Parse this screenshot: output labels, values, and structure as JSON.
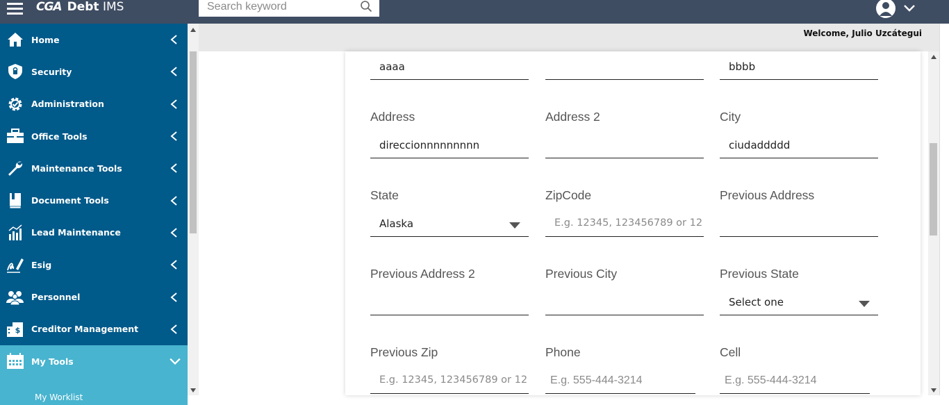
{
  "header": {
    "logo_mark": "CGA",
    "app_name_bold": "Debt",
    "app_name": "IMS",
    "search_placeholder": "Search keyword"
  },
  "welcome_text": "Welcome, Julio Uzcátegui",
  "sidebar": {
    "items": [
      {
        "label": "Home",
        "icon": "home-icon"
      },
      {
        "label": "Security",
        "icon": "shield-icon"
      },
      {
        "label": "Administration",
        "icon": "gear-icon"
      },
      {
        "label": "Office Tools",
        "icon": "toolbox-icon"
      },
      {
        "label": "Maintenance Tools",
        "icon": "wrench-icon"
      },
      {
        "label": "Document Tools",
        "icon": "book-icon"
      },
      {
        "label": "Lead Maintenance",
        "icon": "chart-icon"
      },
      {
        "label": "Esig",
        "icon": "signature-icon"
      },
      {
        "label": "Personnel",
        "icon": "people-icon"
      },
      {
        "label": "Creditor Management",
        "icon": "building-icon"
      },
      {
        "label": "My Tools",
        "icon": "calendar-icon"
      }
    ],
    "sub_items": [
      "My Worklist"
    ]
  },
  "form": {
    "row0": {
      "c1_value": "aaaa",
      "c2_value": "",
      "c3_value": "bbbb"
    },
    "address": {
      "label": "Address",
      "value": "direccionnnnnnnnn"
    },
    "address2": {
      "label": "Address 2",
      "value": ""
    },
    "city": {
      "label": "City",
      "value": "ciudaddddd"
    },
    "state": {
      "label": "State",
      "value": "Alaska"
    },
    "zipcode": {
      "label": "ZipCode",
      "placeholder": "E.g. 12345, 123456789 or 12"
    },
    "previous_address": {
      "label": "Previous Address",
      "value": ""
    },
    "previous_address2": {
      "label": "Previous Address 2",
      "value": ""
    },
    "previous_city": {
      "label": "Previous City",
      "value": ""
    },
    "previous_state": {
      "label": "Previous State",
      "value": "Select one"
    },
    "previous_zip": {
      "label": "Previous Zip",
      "placeholder": "E.g. 12345, 123456789 or 12"
    },
    "phone": {
      "label": "Phone",
      "placeholder": "E.g. 555-444-3214"
    },
    "cell": {
      "label": "Cell",
      "placeholder": "E.g. 555-444-3214"
    }
  },
  "colors": {
    "topbar": "#3f4d63",
    "sidebar": "#005a8a",
    "sidebar_active": "#48b4cf"
  }
}
